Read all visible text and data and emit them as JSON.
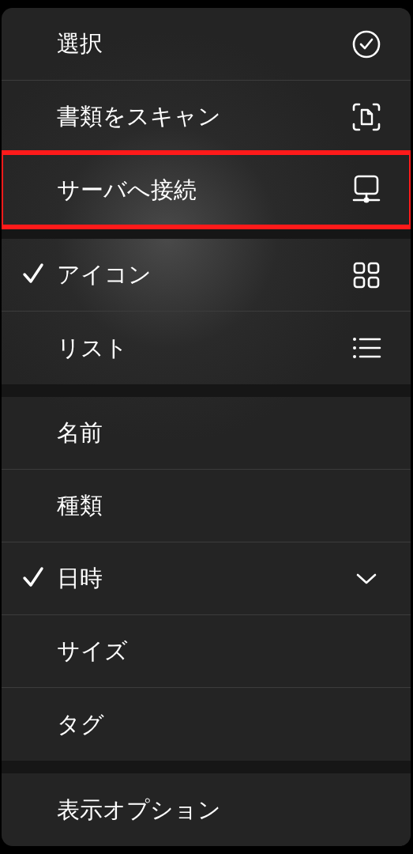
{
  "sections": [
    {
      "items": [
        {
          "label": "選択",
          "checked": false,
          "highlighted": false,
          "kind": "check-circle"
        },
        {
          "label": "書類をスキャン",
          "checked": false,
          "highlighted": false,
          "kind": "scan"
        },
        {
          "label": "サーバへ接続",
          "checked": false,
          "highlighted": true,
          "kind": "server"
        }
      ]
    },
    {
      "items": [
        {
          "label": "アイコン",
          "checked": true,
          "highlighted": false,
          "kind": "grid"
        },
        {
          "label": "リスト",
          "checked": false,
          "highlighted": false,
          "kind": "list"
        }
      ]
    },
    {
      "items": [
        {
          "label": "名前",
          "checked": false,
          "highlighted": false,
          "kind": "plain"
        },
        {
          "label": "種類",
          "checked": false,
          "highlighted": false,
          "kind": "plain"
        },
        {
          "label": "日時",
          "checked": true,
          "highlighted": false,
          "kind": "sort"
        },
        {
          "label": "サイズ",
          "checked": false,
          "highlighted": false,
          "kind": "plain"
        },
        {
          "label": "タグ",
          "checked": false,
          "highlighted": false,
          "kind": "plain"
        }
      ]
    },
    {
      "items": [
        {
          "label": "表示オプション",
          "checked": false,
          "highlighted": false,
          "kind": "plain"
        }
      ]
    }
  ]
}
